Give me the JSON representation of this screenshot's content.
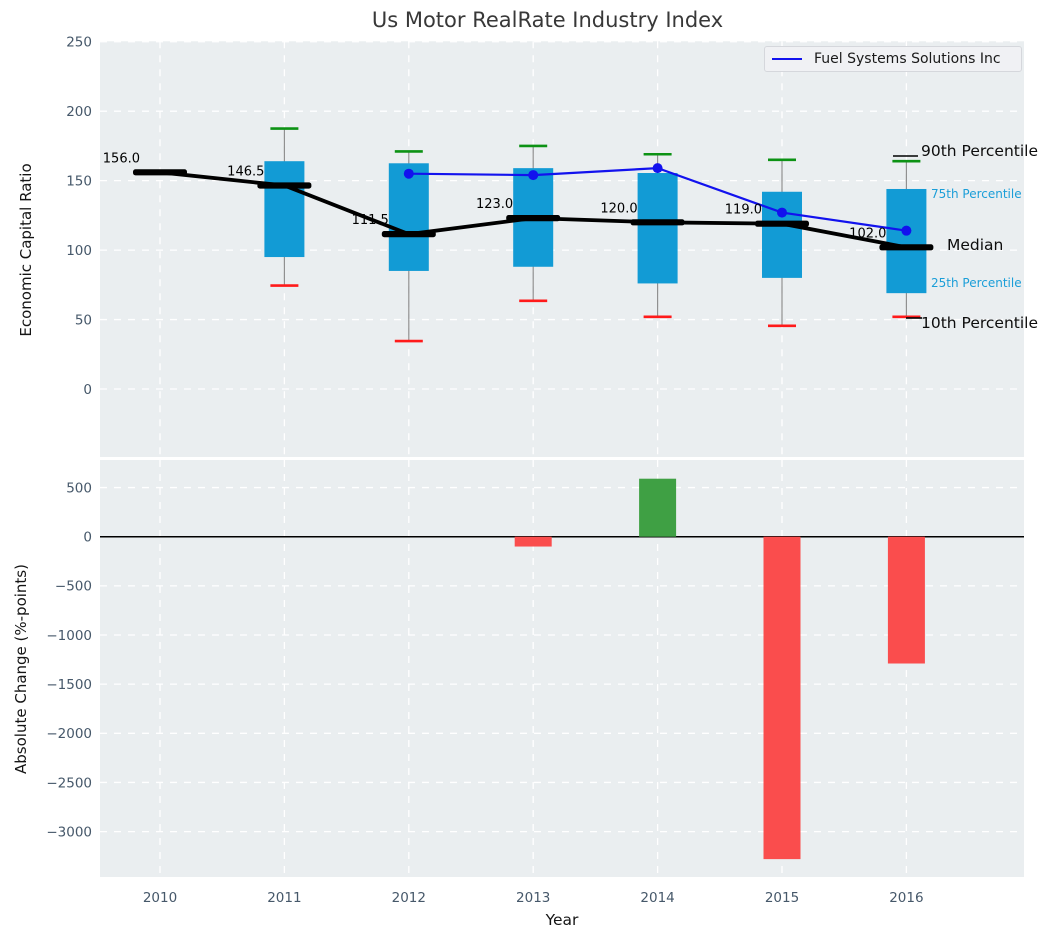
{
  "legend": {
    "label": "Fuel Systems Solutions Inc"
  },
  "annotations": {
    "p90": "90th Percentile",
    "p75": "75th Percentile",
    "median": "Median",
    "p25": "25th Percentile",
    "p10": "10th Percentile"
  },
  "colors": {
    "plot_bg": "#eaeef0",
    "grid": "#ffffff",
    "tick": "#46586a",
    "box_fill": "#129bd5",
    "cap_green": "#0c9214",
    "cap_red": "#ff1a1a",
    "bar_pos": "#3fa044",
    "bar_neg": "#fa4d4d",
    "whisker": "#909090",
    "median": "#000000",
    "company_line": "#1212ee",
    "zero_line": "#000000",
    "annotation_cyan": "#1b9ed8"
  },
  "chart_data": [
    {
      "type": "line",
      "subtype": "percentile-band-boxes-with-median-line",
      "title": "Us Motor RealRate Industry Index",
      "ylabel": "Economic Capital Ratio",
      "ylim": [
        -50,
        250
      ],
      "yticks": [
        0,
        50,
        100,
        150,
        200,
        250
      ],
      "ytick_labels": [
        "0",
        "50",
        "100",
        "150",
        "200",
        "250"
      ],
      "x": [
        2010,
        2011,
        2012,
        2013,
        2014,
        2015,
        2016
      ],
      "median": [
        156.0,
        146.5,
        111.5,
        123.0,
        120.0,
        119.0,
        102.0
      ],
      "median_labels": [
        "156.0",
        "146.5",
        "111.5",
        "123.0",
        "120.0",
        "119.0",
        "102.0"
      ],
      "q3_75th": [
        null,
        164,
        162.5,
        159,
        155.5,
        142,
        144
      ],
      "q1_25th": [
        null,
        95,
        85,
        88,
        76,
        80,
        69
      ],
      "p90": [
        null,
        187.5,
        171,
        175,
        169,
        165,
        164
      ],
      "p10": [
        null,
        74.5,
        34.5,
        63.5,
        52,
        45.5,
        52
      ],
      "series": [
        {
          "name": "Fuel Systems Solutions Inc",
          "x": [
            2012,
            2013,
            2014,
            2015,
            2016
          ],
          "values": [
            155,
            154,
            159,
            127,
            114
          ]
        }
      ],
      "legend_position": "upper right",
      "grid": true
    },
    {
      "type": "bar",
      "ylabel": "Absolute Change (%-points)",
      "xlabel": "Year",
      "ylim": [
        -3460,
        780
      ],
      "yticks": [
        500,
        0,
        -500,
        -1000,
        -1500,
        -2000,
        -2500,
        -3000
      ],
      "ytick_labels": [
        "500",
        "0",
        "−500",
        "−1000",
        "−1500",
        "−2000",
        "−2500",
        "−3000"
      ],
      "categories": [
        2010,
        2011,
        2012,
        2013,
        2014,
        2015,
        2016
      ],
      "xtick_labels": [
        "2010",
        "2011",
        "2012",
        "2013",
        "2014",
        "2015",
        "2016"
      ],
      "values": [
        0,
        0,
        0,
        -100,
        590,
        -3280,
        -1290
      ],
      "grid": true
    }
  ]
}
